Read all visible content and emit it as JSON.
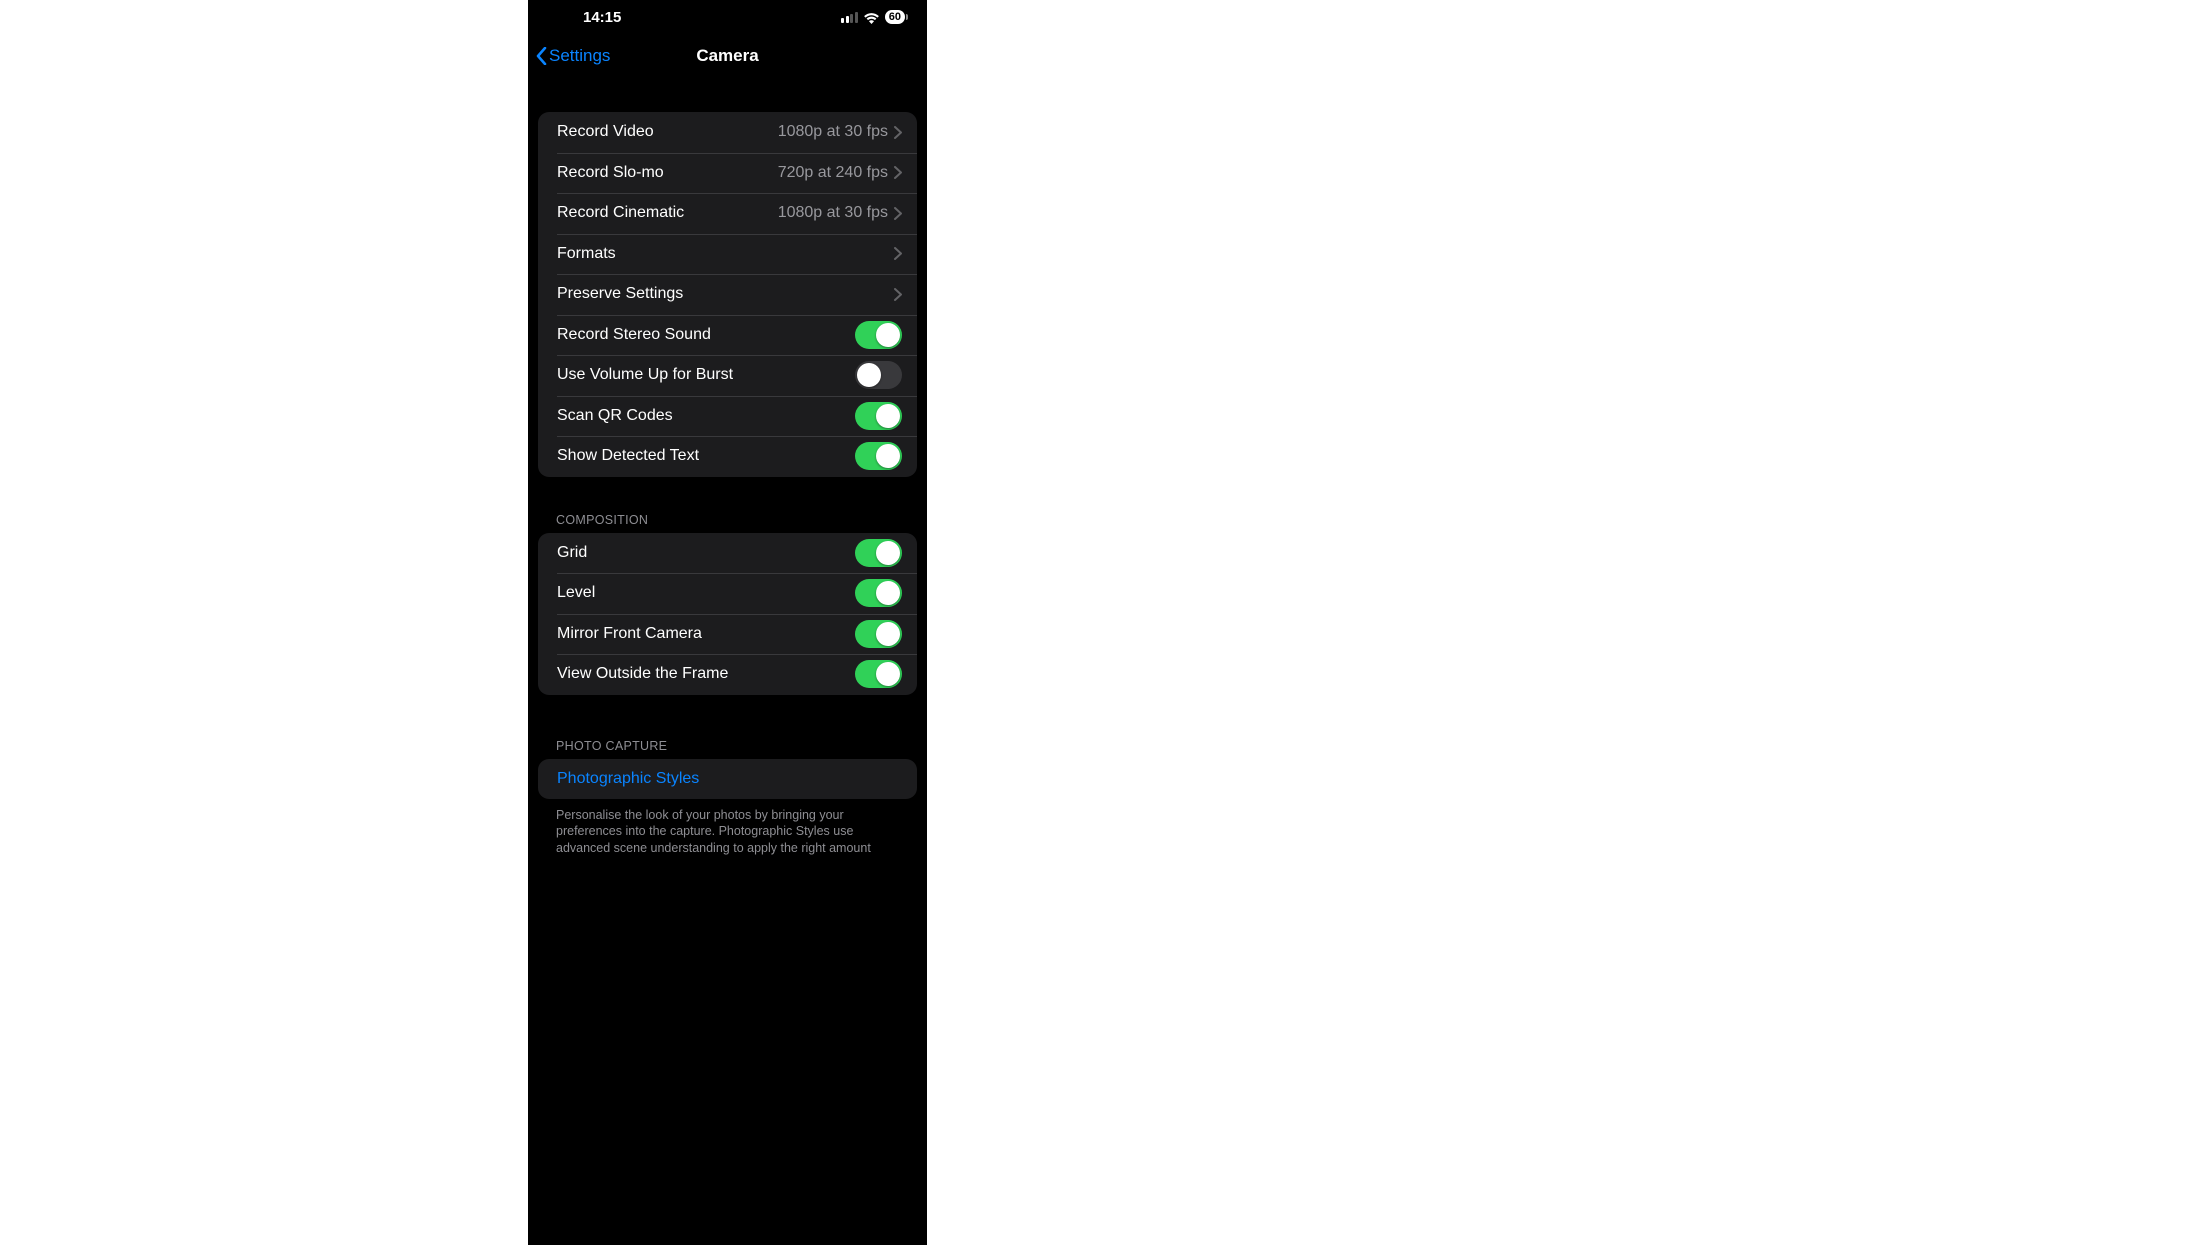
{
  "status": {
    "time": "14:15",
    "battery": "60"
  },
  "nav": {
    "back": "Settings",
    "title": "Camera"
  },
  "group1": {
    "recordVideo": {
      "label": "Record Video",
      "value": "1080p at 30 fps"
    },
    "recordSlomo": {
      "label": "Record Slo-mo",
      "value": "720p at 240 fps"
    },
    "recordCinematic": {
      "label": "Record Cinematic",
      "value": "1080p at 30 fps"
    },
    "formats": {
      "label": "Formats"
    },
    "preserve": {
      "label": "Preserve Settings"
    },
    "stereo": {
      "label": "Record Stereo Sound",
      "on": true
    },
    "volBurst": {
      "label": "Use Volume Up for Burst",
      "on": false
    },
    "qr": {
      "label": "Scan QR Codes",
      "on": true
    },
    "detectedText": {
      "label": "Show Detected Text",
      "on": true
    }
  },
  "compositionHeader": "COMPOSITION",
  "group2": {
    "grid": {
      "label": "Grid",
      "on": true
    },
    "level": {
      "label": "Level",
      "on": true
    },
    "mirror": {
      "label": "Mirror Front Camera",
      "on": true
    },
    "outside": {
      "label": "View Outside the Frame",
      "on": true
    }
  },
  "photoCaptureHeader": "PHOTO CAPTURE",
  "group3": {
    "styles": {
      "label": "Photographic Styles"
    }
  },
  "stylesFooter": "Personalise the look of your photos by bringing your preferences into the capture. Photographic Styles use advanced scene understanding to apply the right amount"
}
